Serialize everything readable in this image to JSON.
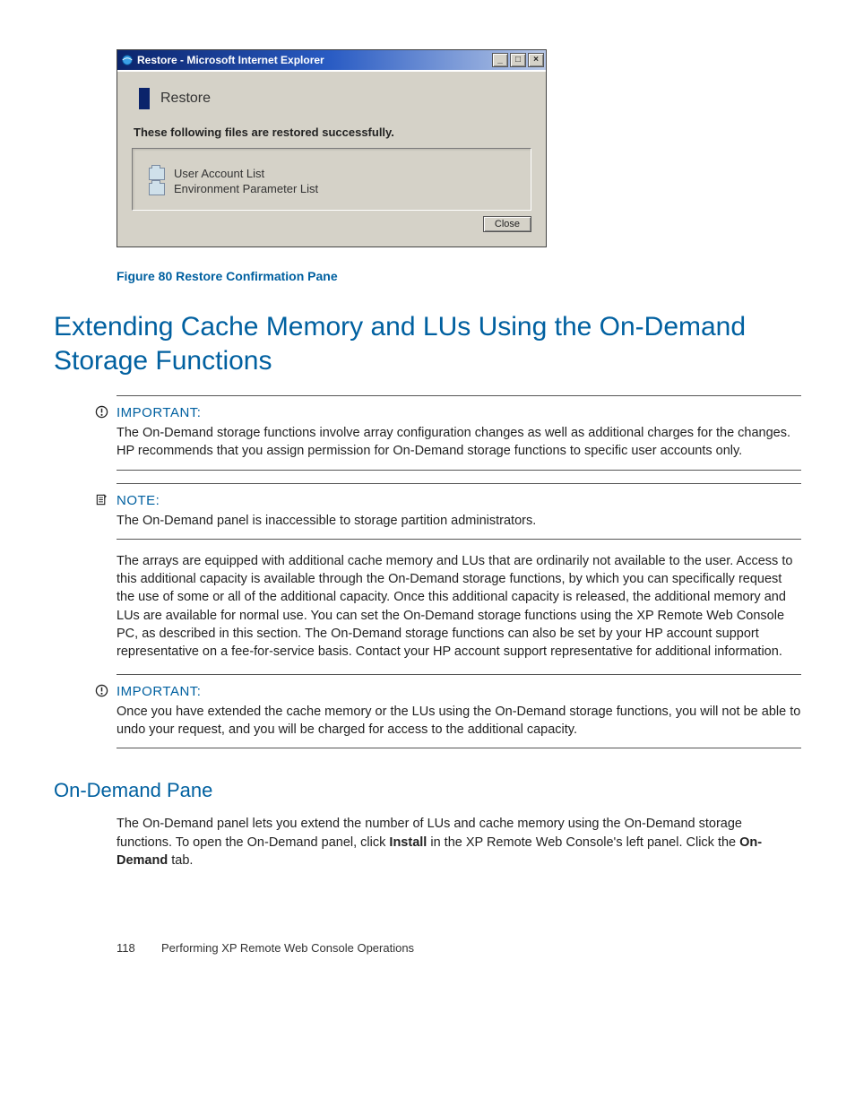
{
  "dialog": {
    "title": "Restore - Microsoft Internet Explorer",
    "heading": "Restore",
    "message": "These following files are restored successfully.",
    "files": [
      "User Account List",
      "Environment Parameter List"
    ],
    "close_label": "Close"
  },
  "figure_caption": "Figure 80 Restore Confirmation Pane",
  "section_heading": "Extending Cache Memory and LUs Using the On-Demand Storage Functions",
  "callouts": {
    "important1": {
      "label": "IMPORTANT:",
      "body": "The On-Demand storage functions involve array configuration changes as well as additional charges for the changes. HP recommends that you assign permission for On-Demand storage functions to specific user accounts only."
    },
    "note1": {
      "label": "NOTE:",
      "body": "The On-Demand panel is inaccessible to storage partition administrators."
    },
    "important2": {
      "label": "IMPORTANT:",
      "body": "Once you have extended the cache memory or the LUs using the On-Demand storage functions, you will not be able to undo your request, and you will be charged for access to the additional capacity."
    }
  },
  "paragraph1": "The arrays are equipped with additional cache memory and LUs that are ordinarily not available to the user. Access to this additional capacity is available through the On-Demand storage functions, by which you can specifically request the use of some or all of the additional capacity. Once this additional capacity is released, the additional memory and LUs are available for normal use. You can set the On-Demand storage functions using the XP Remote Web Console PC, as described in this section. The On-Demand storage functions can also be set by your HP account support representative on a fee-for-service basis. Contact your HP account support representative for additional information.",
  "subsection_heading": "On-Demand Pane",
  "p2_pre": "The On-Demand panel lets you extend the number of LUs and cache memory using the On-Demand storage functions. To open the On-Demand panel, click ",
  "p2_b1": "Install",
  "p2_mid": " in the XP Remote Web Console's left panel. Click the ",
  "p2_b2": "On-Demand",
  "p2_post": " tab.",
  "footer": {
    "page_number": "118",
    "running_title": "Performing XP Remote Web Console Operations"
  }
}
